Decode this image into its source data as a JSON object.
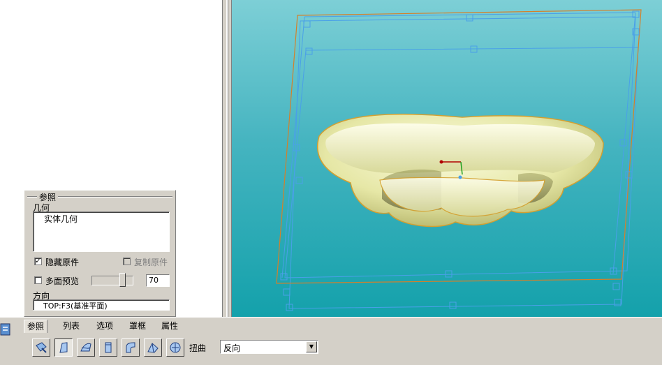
{
  "reference_panel": {
    "title": "参照",
    "geometry_label": "几何",
    "geometry_items": [
      "实体几何"
    ],
    "hide_original": {
      "label": "隐藏原件",
      "checked": true
    },
    "copy_original": {
      "label": "复制原件",
      "checked": false,
      "enabled": false
    },
    "multi_preview": {
      "label": "多面预览",
      "checked": false
    },
    "preview_level": "70",
    "preview_level_fraction": 0.75,
    "direction_label": "方向",
    "direction_value": "TOP:F3(基准平面)"
  },
  "dashboard": {
    "tabs": [
      {
        "label": "参照",
        "active": true
      },
      {
        "label": "列表",
        "active": false
      },
      {
        "label": "选项",
        "active": false
      },
      {
        "label": "罩框",
        "active": false
      },
      {
        "label": "属性",
        "active": false
      }
    ],
    "tool_icons": [
      "transform-icon",
      "warp-icon",
      "spine-icon",
      "stretch-icon",
      "bend-icon",
      "twist-icon",
      "sculpt-icon"
    ],
    "twist_label": "扭曲",
    "direction_select": "反向"
  },
  "colors": {
    "viewport_top": "#7dcfd6",
    "viewport_bottom": "#14a1ab",
    "model_fill": "#eceeb0",
    "datum_orange": "#d4802a",
    "datum_blue": "#4aa0e8"
  }
}
